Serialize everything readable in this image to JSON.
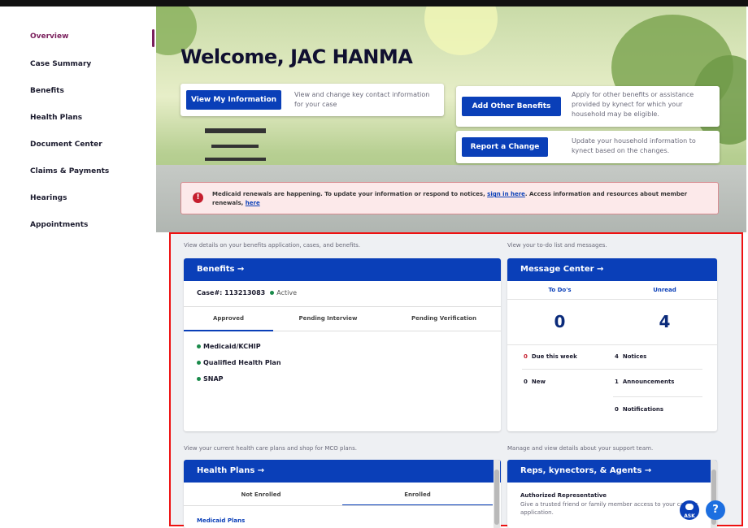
{
  "sidebar": {
    "items": [
      {
        "label": "Overview"
      },
      {
        "label": "Case Summary"
      },
      {
        "label": "Benefits"
      },
      {
        "label": "Health Plans"
      },
      {
        "label": "Document Center"
      },
      {
        "label": "Claims & Payments"
      },
      {
        "label": "Hearings"
      },
      {
        "label": "Appointments"
      }
    ]
  },
  "hero": {
    "title": "Welcome, JAC HANMA",
    "view_info": {
      "button": "View My Information",
      "desc": "View and change key contact information for your case"
    },
    "add_benefits": {
      "button": "Add Other Benefits",
      "desc": "Apply for other benefits or assistance provided by kynect for which your household may be eligible."
    },
    "report_change": {
      "button": "Report a Change",
      "desc": "Update your household information to kynect based on the changes."
    },
    "alert": {
      "text_before": "Medicaid renewals are happening. To update your information or respond to notices, ",
      "link1": "sign in here",
      "text_middle": ". Access information and resources about member renewals, ",
      "link2": "here"
    }
  },
  "main": {
    "benefits_note": "View details on your benefits application, cases, and benefits.",
    "todo_note": "View your to-do list and messages.",
    "benefits": {
      "title": "Benefits →",
      "case_label": "Case#: 113213083",
      "case_status": "Active",
      "tabs": [
        "Approved",
        "Pending Interview",
        "Pending Verification"
      ],
      "items": [
        "Medicaid/KCHIP",
        "Qualified Health Plan",
        "SNAP"
      ]
    },
    "message_center": {
      "title": "Message Center →",
      "col1": "To Do's",
      "col2": "Unread",
      "todo_count": "0",
      "unread_count": "4",
      "due_num": "0",
      "due_label": "Due this week",
      "new_num": "0",
      "new_label": "New",
      "notices_num": "4",
      "notices_label": "Notices",
      "announcements_num": "1",
      "announcements_label": "Announcements",
      "notifications_num": "0",
      "notifications_label": "Notifications"
    },
    "health_note": "View your current health care plans and shop for MCO plans.",
    "support_note": "Manage and view details about your support team.",
    "health_plans": {
      "title": "Health Plans →",
      "tabs": [
        "Not Enrolled",
        "Enrolled"
      ],
      "first_item": "Medicaid Plans"
    },
    "reps": {
      "title": "Reps, kynectors, & Agents →",
      "item_title": "Authorized Representative",
      "item_desc": "Give a trusted friend or family member access to your case or application."
    },
    "chat_label": "ASK",
    "help_label": "?"
  },
  "colors": {
    "primary_blue": "#0a3fb8",
    "accent_purple": "#7a1f5c",
    "alert_red": "#c51e2e",
    "active_green": "#1a8a4a",
    "highlight_red_border": "#ee1111"
  }
}
